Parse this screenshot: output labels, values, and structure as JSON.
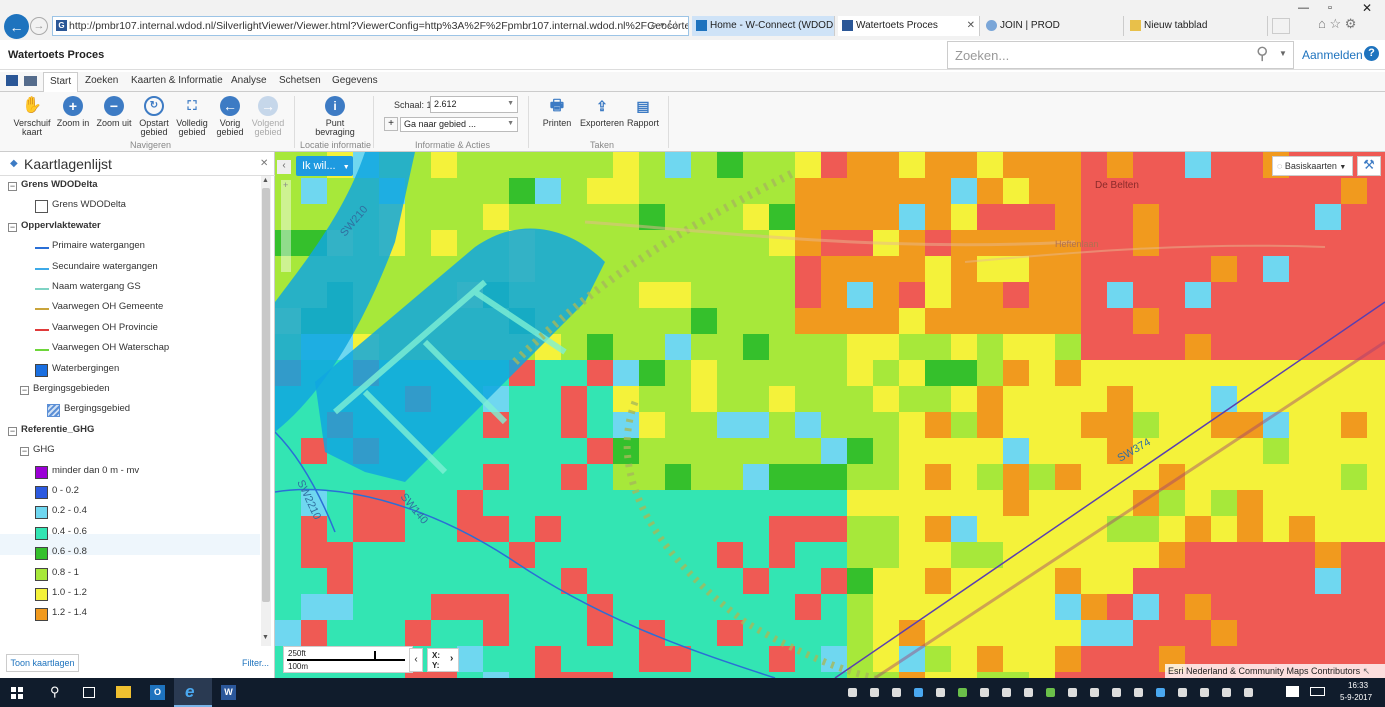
{
  "browser": {
    "address": "http://pmbr107.internal.wdod.nl/SilverlightViewer/Viewer.html?ViewerConfig=http%3A%2F%2Fpmbr107.internal.wdod.nl%2FGeocortex%2FEssentials%2",
    "tabs": [
      {
        "label": "Home - W-Connect (WDOD in..."
      },
      {
        "label": "Watertoets Proces"
      },
      {
        "label": "JOIN | PROD"
      },
      {
        "label": "Nieuw tabblad"
      }
    ]
  },
  "app": {
    "title": "Watertoets Proces",
    "search_placeholder": "Zoeken...",
    "signin": "Aanmelden"
  },
  "ribbon": {
    "tabs": [
      "Start",
      "Zoeken",
      "Kaarten & Informatie",
      "Analyse",
      "Schetsen",
      "Gegevens"
    ],
    "tools": [
      {
        "l1": "Verschuif",
        "l2": "kaart",
        "icon": "hand-icon"
      },
      {
        "l1": "Zoom in",
        "l2": "",
        "icon": "zoom-in-icon"
      },
      {
        "l1": "Zoom uit",
        "l2": "",
        "icon": "zoom-out-icon"
      },
      {
        "l1": "Opstart",
        "l2": "gebied",
        "icon": "home-extent-icon"
      },
      {
        "l1": "Volledig",
        "l2": "gebied",
        "icon": "full-extent-icon"
      },
      {
        "l1": "Vorig",
        "l2": "gebied",
        "icon": "back-icon"
      },
      {
        "l1": "Volgend",
        "l2": "gebied",
        "icon": "forward-icon"
      },
      {
        "l1": "Punt",
        "l2": "bevraging",
        "icon": "info-icon"
      }
    ],
    "groups": {
      "navigate": "Navigeren",
      "location": "Locatie informatie",
      "info": "Informatie & Acties",
      "tasks": "Taken"
    },
    "scale_label": "Schaal: 1:",
    "scale_value": "2.612",
    "goto_area": "Ga naar gebied ...",
    "print": "Printen",
    "export": "Exporteren",
    "report": "Rapport"
  },
  "layers": {
    "title": "Kaartlagenlijst",
    "items": [
      {
        "label": "Grens WDODelta",
        "kind": "group"
      },
      {
        "label": "Grens WDODelta",
        "kind": "box"
      },
      {
        "label": "Oppervlaktewater",
        "kind": "group"
      },
      {
        "label": "Primaire watergangen",
        "kind": "line",
        "color": "#2a6fd6"
      },
      {
        "label": "Secundaire watergangen",
        "kind": "line",
        "color": "#3da9e8"
      },
      {
        "label": "Naam watergang GS",
        "kind": "line",
        "color": "#7fd3c4"
      },
      {
        "label": "Vaarwegen OH Gemeente",
        "kind": "line",
        "color": "#c9a43b"
      },
      {
        "label": "Vaarwegen OH Provincie",
        "kind": "line",
        "color": "#e03a3a"
      },
      {
        "label": "Vaarwegen OH Waterschap",
        "kind": "line",
        "color": "#6ed63a"
      },
      {
        "label": "Waterbergingen",
        "kind": "fill",
        "color": "#1a6fe0"
      },
      {
        "label": "Bergingsgebieden",
        "kind": "sub"
      },
      {
        "label": "Bergingsgebied",
        "kind": "hatch"
      },
      {
        "label": "Referentie_GHG",
        "kind": "group"
      },
      {
        "label": "GHG",
        "kind": "sub"
      },
      {
        "label": "minder dan 0 m - mv",
        "kind": "fill",
        "color": "#9b00d6"
      },
      {
        "label": "0 - 0.2",
        "kind": "fill",
        "color": "#2c5ae0"
      },
      {
        "label": "0.2 - 0.4",
        "kind": "fill",
        "color": "#6fd7f0"
      },
      {
        "label": "0.4 - 0.6",
        "kind": "fill",
        "color": "#33e5b3"
      },
      {
        "label": "0.6 - 0.8",
        "kind": "fill",
        "color": "#35c02c"
      },
      {
        "label": "0.8 - 1",
        "kind": "fill",
        "color": "#a7e83a"
      },
      {
        "label": "1.0 - 1.2",
        "kind": "fill",
        "color": "#f4f23a"
      },
      {
        "label": "1.2 - 1.4",
        "kind": "fill",
        "color": "#f19a1e"
      }
    ],
    "show_button": "Toon kaartlagen",
    "filter": "Filter..."
  },
  "map": {
    "ik_wil": "Ik wil...",
    "basemaps": "Basiskaarten",
    "scalebar_top": "250ft",
    "scalebar_bottom": "100m",
    "coord_x": "X:",
    "coord_y": "Y:",
    "attribution": "Esri Nederland & Community Maps Contributors",
    "place_label": "De Belten",
    "road_label": "Heftenlaan",
    "route_labels": [
      "SW210",
      "SW2210",
      "SW140",
      "SW374"
    ]
  },
  "taskbar": {
    "time": "16:33",
    "date": "5-9-2017"
  },
  "colors": {
    "accent": "#1e73be",
    "ribbon_icon": "#3d7bc4",
    "taskbar": "#101c2c"
  }
}
